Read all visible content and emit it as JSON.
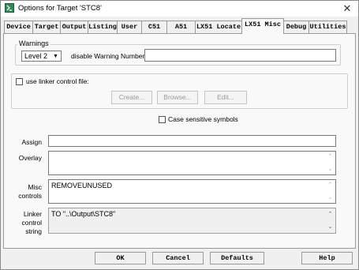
{
  "window": {
    "title": "Options for Target 'STC8'",
    "close_glyph": "✕"
  },
  "tabs": [
    {
      "label": "Device",
      "active": false
    },
    {
      "label": "Target",
      "active": false
    },
    {
      "label": "Output",
      "active": false
    },
    {
      "label": "Listing",
      "active": false
    },
    {
      "label": "User",
      "active": false
    },
    {
      "label": "C51",
      "active": false
    },
    {
      "label": "A51",
      "active": false
    },
    {
      "label": "LX51 Locate",
      "active": false
    },
    {
      "label": "LX51 Misc",
      "active": true
    },
    {
      "label": "Debug",
      "active": false
    },
    {
      "label": "Utilities",
      "active": false
    }
  ],
  "warnings": {
    "legend": "Warnings",
    "level_value": "Level 2",
    "disable_label": "disable Warning Numbers:",
    "disable_value": ""
  },
  "linker_control_file": {
    "checkbox_label": "use linker control file:",
    "checked": false,
    "create_label": "Create...",
    "browse_label": "Browse...",
    "edit_label": "Edit..."
  },
  "case_sensitive": {
    "label": "Case sensitive symbols",
    "checked": false
  },
  "assign": {
    "label": "Assign",
    "value": ""
  },
  "overlay": {
    "label": "Overlay",
    "value": ""
  },
  "misc_controls": {
    "label_line1": "Misc",
    "label_line2": "controls",
    "value": "REMOVEUNUSED"
  },
  "linker_control_string": {
    "label_line1": "Linker",
    "label_line2": "control",
    "label_line3": "string",
    "value": "TO \"..\\Output\\STC8\""
  },
  "buttons": {
    "ok": "OK",
    "cancel": "Cancel",
    "defaults": "Defaults",
    "help": "Help"
  },
  "icons": {
    "scroll_up": "up-arrow-icon",
    "scroll_down": "down-arrow-icon",
    "combo": "chevron-down-icon",
    "app": "keil-app-icon"
  }
}
